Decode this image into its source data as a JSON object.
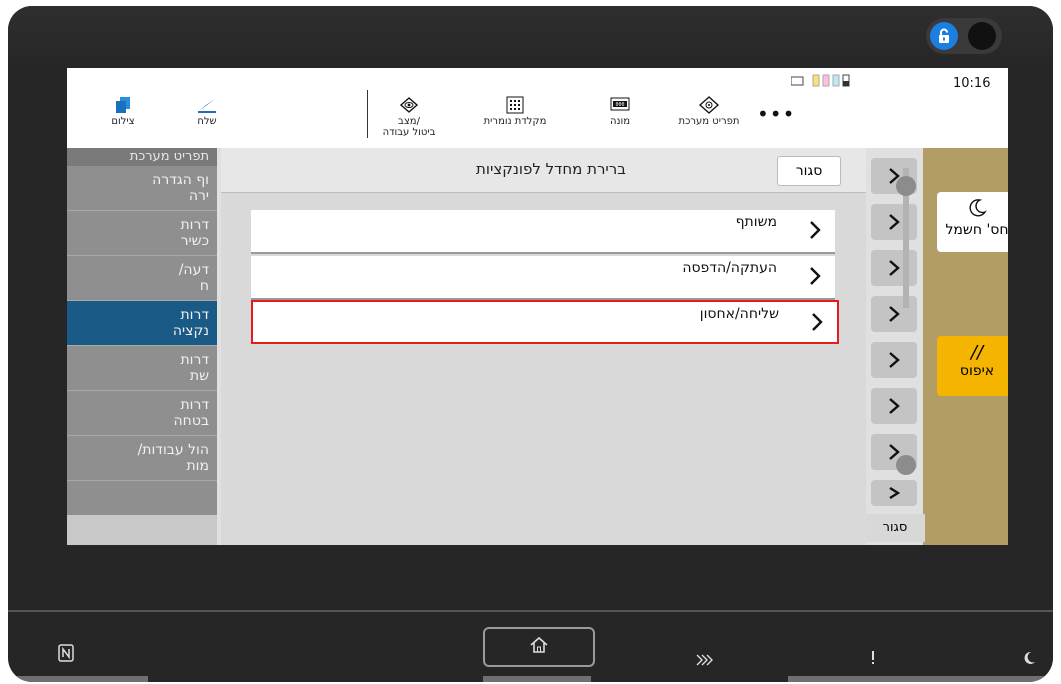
{
  "header": {
    "clock": "10:16",
    "items": [
      {
        "label": "צילום",
        "icon": "copy-icon"
      },
      {
        "label": "שלח",
        "icon": "send-icon"
      },
      {
        "label_line1": "מצב/",
        "label_line2": "ביטול עבודה",
        "icon": "eye-icon"
      },
      {
        "label": "מקלדת נומרית",
        "icon": "keypad-icon"
      },
      {
        "label": "מונה",
        "icon": "counter-icon"
      },
      {
        "label": "תפריט מערכת",
        "icon": "system-menu-icon"
      }
    ],
    "more_label": "•••"
  },
  "left_menu": {
    "header": "תפריט מערכת",
    "items": [
      {
        "line1": "וף הגדרה",
        "line2": "ירה"
      },
      {
        "line1": "דרות",
        "line2": "כשיר"
      },
      {
        "line1": "דעה/",
        "line2": "ח"
      },
      {
        "line1": "דרות",
        "line2": "נקציה"
      },
      {
        "line1": "דרות",
        "line2": "שת"
      },
      {
        "line1": "דרות",
        "line2": "בטחה"
      },
      {
        "line1": "הול עבודות/",
        "line2": "מות"
      }
    ]
  },
  "dialog": {
    "title": "ברירת מחדל לפונקציות",
    "close_label": "סגור",
    "rows": [
      {
        "label": "משותף"
      },
      {
        "label": "העתקה/הדפסה"
      },
      {
        "label": "שליחה/אחסון"
      }
    ]
  },
  "side_panel": {
    "sleep_label": "חס' חשמל",
    "reset_label": "איפוס",
    "bottom_close_label": "סגור"
  },
  "colors": {
    "selected_row_border": "#e01e1e",
    "reset_button": "#f5b400",
    "selected_menu": "#1a5a86",
    "lock_toggle": "#1b7ee0"
  }
}
